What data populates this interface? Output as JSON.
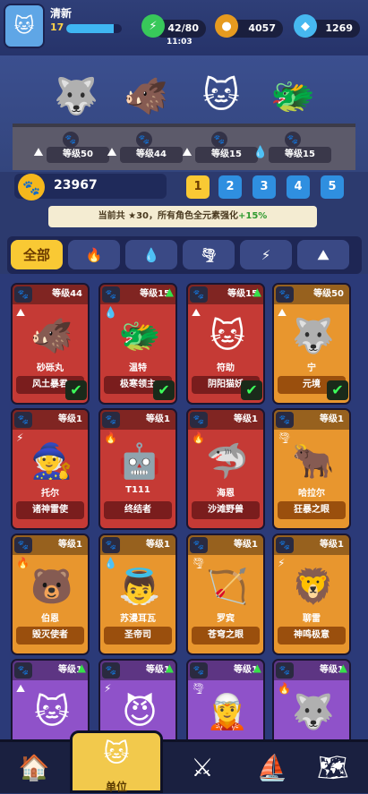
{
  "player": {
    "name": "清新",
    "level": "17",
    "xp_fraction": 0.86
  },
  "resources": {
    "energy": "42/80",
    "timer": "11:03",
    "gold": "4057",
    "gems": "1269"
  },
  "showcase": [
    {
      "level": "等级50",
      "element": "earth"
    },
    {
      "level": "等级44",
      "element": "earth"
    },
    {
      "level": "等级15",
      "element": "earth"
    },
    {
      "level": "等级15",
      "element": "water"
    }
  ],
  "power": "23967",
  "teams": [
    "1",
    "2",
    "3",
    "4",
    "5"
  ],
  "bonus": {
    "prefix": "当前共",
    "count": "30",
    "middle": "，所有角色全元素强化",
    "value": "+15%"
  },
  "filters": [
    "全部",
    "🔥",
    "💧",
    "🌪",
    "⚡",
    "⛰"
  ],
  "cards": [
    {
      "level": "等级44",
      "name": "砂砾丸",
      "title": "风土暴君",
      "el": "⛰",
      "art": "🐗",
      "color": "red",
      "check": true,
      "up": false
    },
    {
      "level": "等级15",
      "name": "温特",
      "title": "极寒领主",
      "el": "💧",
      "art": "🐲",
      "color": "red",
      "check": true,
      "up": true
    },
    {
      "level": "等级15",
      "name": "符助",
      "title": "阴阳猫妖",
      "el": "⛰",
      "art": "🐱",
      "color": "red",
      "check": true,
      "up": true
    },
    {
      "level": "等级50",
      "name": "宁",
      "title": "元境",
      "el": "⛰",
      "art": "🐺",
      "color": "orange",
      "check": true,
      "up": false
    },
    {
      "level": "等级1",
      "name": "托尔",
      "title": "诸神雷使",
      "el": "⚡",
      "art": "🧙",
      "color": "red",
      "check": false,
      "up": false
    },
    {
      "level": "等级1",
      "name": "T111",
      "title": "终结者",
      "el": "🔥",
      "art": "🤖",
      "color": "red",
      "check": false,
      "up": false
    },
    {
      "level": "等级1",
      "name": "海恩",
      "title": "沙滩野兽",
      "el": "🔥",
      "art": "🦈",
      "color": "red",
      "check": false,
      "up": false
    },
    {
      "level": "等级1",
      "name": "哈拉尔",
      "title": "狂暴之眼",
      "el": "🌪",
      "art": "🐂",
      "color": "orange",
      "check": false,
      "up": false
    },
    {
      "level": "等级1",
      "name": "伯恩",
      "title": "毁灭使者",
      "el": "🔥",
      "art": "🐻",
      "color": "orange",
      "check": false,
      "up": false
    },
    {
      "level": "等级1",
      "name": "苏漫耳瓦",
      "title": "圣帝司",
      "el": "💧",
      "art": "👼",
      "color": "orange",
      "check": false,
      "up": false
    },
    {
      "level": "等级1",
      "name": "罗宾",
      "title": "苍穹之眼",
      "el": "🌪",
      "art": "🏹",
      "color": "orange",
      "check": false,
      "up": false
    },
    {
      "level": "等级1",
      "name": "聊雷",
      "title": "神鸣极意",
      "el": "⚡",
      "art": "🦁",
      "color": "orange",
      "check": false,
      "up": false
    },
    {
      "level": "等级1",
      "name": "",
      "title": "",
      "el": "⛰",
      "art": "🐱",
      "color": "purple",
      "check": false,
      "up": true
    },
    {
      "level": "等级1",
      "name": "",
      "title": "",
      "el": "⚡",
      "art": "😈",
      "color": "purple",
      "check": false,
      "up": true
    },
    {
      "level": "等级1",
      "name": "",
      "title": "",
      "el": "🌪",
      "art": "🧝",
      "color": "purple",
      "check": false,
      "up": true
    },
    {
      "level": "等级1",
      "name": "",
      "title": "",
      "el": "🔥",
      "art": "🐺",
      "color": "purple",
      "check": false,
      "up": true
    }
  ],
  "nav": {
    "active_label": "单位"
  }
}
